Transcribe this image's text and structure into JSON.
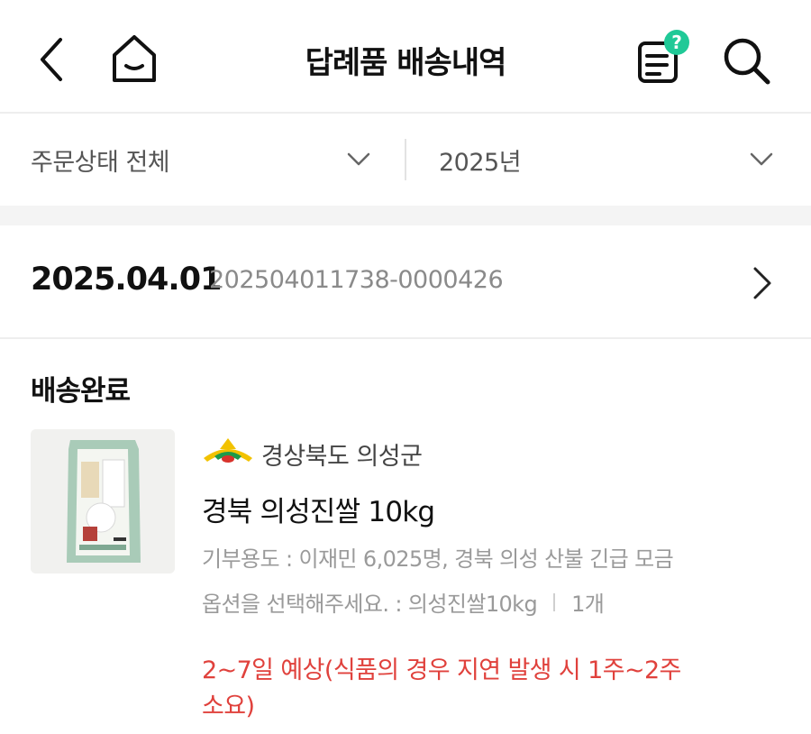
{
  "header": {
    "title": "답례품 배송내역",
    "help_badge": "?"
  },
  "filters": {
    "status": {
      "selected": "주문상태 전체"
    },
    "year": {
      "selected": "2025년"
    }
  },
  "order": {
    "date": "2025.04.01",
    "number": "202504011738-0000426",
    "status": "배송완료",
    "item": {
      "seller": "경상북도 의성군",
      "name": "경북 의성진쌀 10kg",
      "donation_purpose": "기부용도 : 이재민 6,025명, 경북 의성 산불 긴급 모금",
      "option": "옵션을 선택해주세요. : 의성진쌀10kg",
      "quantity": "1개",
      "eta": "2~7일 예상(식품의 경우 지연 발생 시 1주~2주 소요)"
    }
  },
  "colors": {
    "accent": "#20c997",
    "eta_text": "#e0413c",
    "divider": "#eeeeee",
    "section_gap": "#f4f4f4"
  },
  "icons": [
    "chevron-left-icon",
    "home-icon",
    "help-document-icon",
    "search-icon",
    "chevron-down-icon",
    "chevron-right-icon"
  ]
}
